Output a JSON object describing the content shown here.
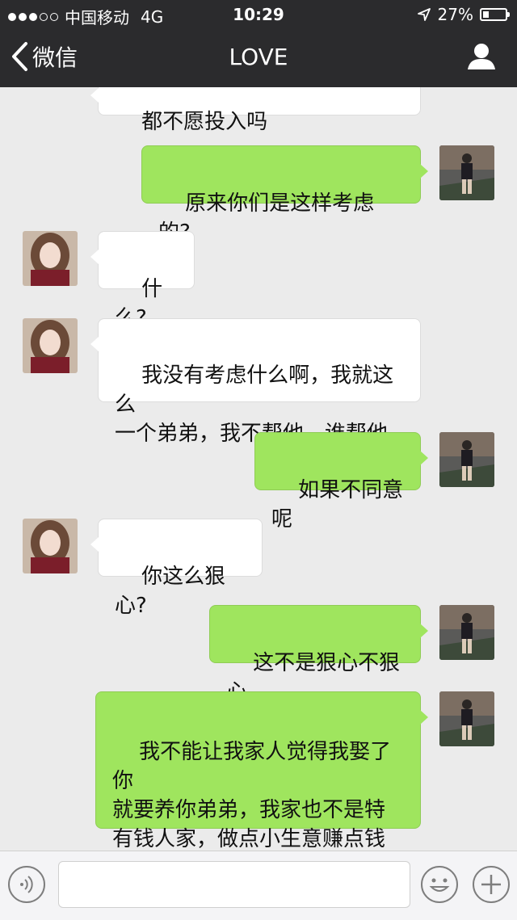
{
  "status_bar": {
    "carrier": "中国移动",
    "network": "4G",
    "time": "10:29",
    "battery": "27%",
    "battery_level": 0.27
  },
  "nav": {
    "back_label": "微信",
    "title": "LOVE"
  },
  "messages": [
    {
      "side": "in",
      "text": "都不愿投入吗"
    },
    {
      "side": "out",
      "text": "原来你们是这样考虑的?"
    },
    {
      "side": "in",
      "text": "什么?"
    },
    {
      "side": "in",
      "text": "我没有考虑什么啊，我就这么\n一个弟弟，我不帮他，谁帮他"
    },
    {
      "side": "out",
      "text": "如果不同意呢"
    },
    {
      "side": "in",
      "text": "你这么狠心?"
    },
    {
      "side": "out",
      "text": "这不是狠心不狠心"
    },
    {
      "side": "out",
      "text": "我不能让我家人觉得我娶了你\n就要养你弟弟，我家也不是特\n有钱人家，做点小生意赚点钱\n很难"
    }
  ],
  "input": {
    "value": "",
    "placeholder": ""
  },
  "colors": {
    "bar": "#2b2b2d",
    "chat_bg": "#ebebeb",
    "out_bubble": "#9fe55e",
    "in_bubble": "#ffffff"
  }
}
